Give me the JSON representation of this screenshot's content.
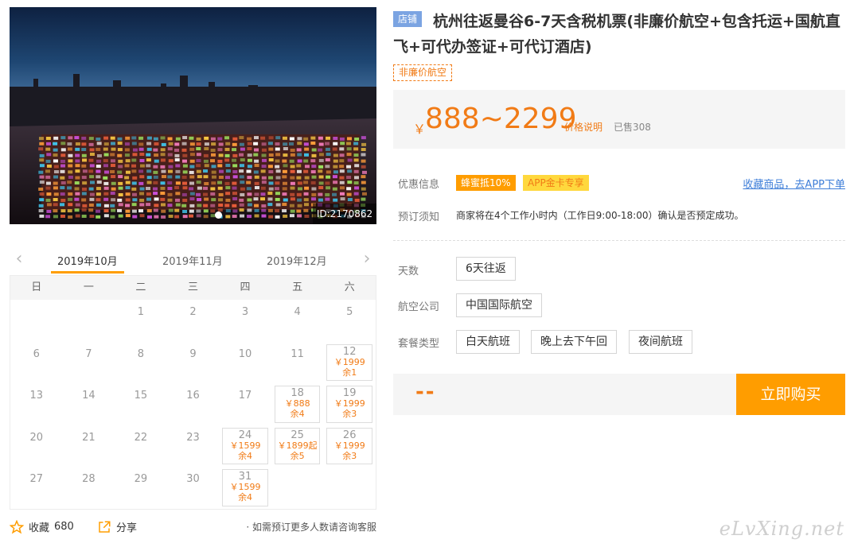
{
  "hero": {
    "image_id": "ID:2170862"
  },
  "calendar": {
    "months": [
      "2019年10月",
      "2019年11月",
      "2019年12月"
    ],
    "weekdays": [
      "日",
      "一",
      "二",
      "三",
      "四",
      "五",
      "六"
    ],
    "rows": [
      [
        {
          "day": ""
        },
        {
          "day": ""
        },
        {
          "day": "1"
        },
        {
          "day": "2"
        },
        {
          "day": "3"
        },
        {
          "day": "4"
        },
        {
          "day": "5"
        }
      ],
      [
        {
          "day": "6"
        },
        {
          "day": "7"
        },
        {
          "day": "8"
        },
        {
          "day": "9"
        },
        {
          "day": "10"
        },
        {
          "day": "11"
        },
        {
          "day": "12",
          "price": "￥1999",
          "stock": "余1"
        }
      ],
      [
        {
          "day": "13"
        },
        {
          "day": "14"
        },
        {
          "day": "15"
        },
        {
          "day": "16"
        },
        {
          "day": "17"
        },
        {
          "day": "18",
          "price": "￥888",
          "stock": "余4"
        },
        {
          "day": "19",
          "price": "￥1999",
          "stock": "余3"
        }
      ],
      [
        {
          "day": "20"
        },
        {
          "day": "21"
        },
        {
          "day": "22"
        },
        {
          "day": "23"
        },
        {
          "day": "24",
          "price": "￥1599",
          "stock": "余4"
        },
        {
          "day": "25",
          "price": "￥1899起",
          "stock": "余5"
        },
        {
          "day": "26",
          "price": "￥1999",
          "stock": "余3"
        }
      ],
      [
        {
          "day": "27"
        },
        {
          "day": "28"
        },
        {
          "day": "29"
        },
        {
          "day": "30"
        },
        {
          "day": "31",
          "price": "￥1599",
          "stock": "余4"
        },
        {
          "day": ""
        },
        {
          "day": ""
        }
      ]
    ]
  },
  "actions": {
    "favorite_label": "收藏",
    "favorite_count": "680",
    "share_label": "分享",
    "note": "· 如需预订更多人数请咨询客服"
  },
  "product": {
    "shop_badge": "店铺",
    "title": "杭州往返曼谷6-7天含税机票(非廉价航空+包含托运+国航直飞+可代办签证+可代订酒店)",
    "airline_tag": "非廉价航空",
    "currency": "￥",
    "price_range": "888~2299",
    "price_explain": "价格说明",
    "sold": "已售308"
  },
  "promo": {
    "label": "优惠信息",
    "tags": [
      "蜂蜜抵10%",
      "APP金卡专享"
    ],
    "fav_link": "收藏商品，去APP下单"
  },
  "booking": {
    "label": "预订须知",
    "notice": "商家将在4个工作小时内（工作日9:00-18:00）确认是否预定成功。"
  },
  "options": {
    "days_label": "天数",
    "days": [
      "6天往返"
    ],
    "airline_label": "航空公司",
    "airlines": [
      "中国国际航空"
    ],
    "package_label": "套餐类型",
    "packages": [
      "白天航班",
      "晚上去下午回",
      "夜间航班"
    ]
  },
  "buy": {
    "selected_price": "--",
    "button": "立即购买"
  },
  "watermark": "eLvXing.net",
  "colors": {
    "accent": "#ff9d00",
    "price": "#f17b16",
    "link": "#3e7ed8",
    "badge": "#7ba4e2"
  }
}
